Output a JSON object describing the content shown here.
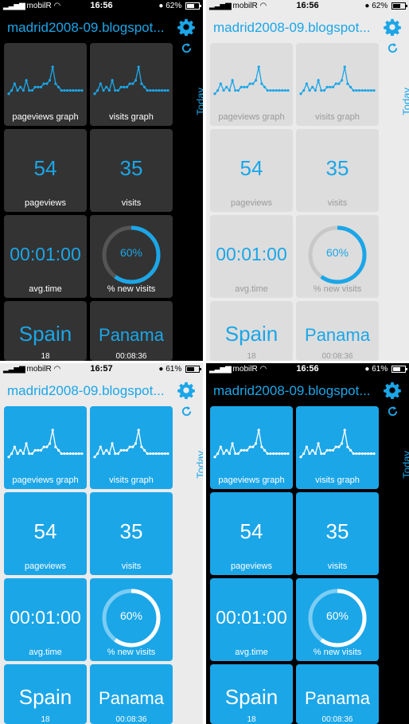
{
  "screens": [
    {
      "carrier": "mobilR",
      "time": "16:56",
      "battery": "62%",
      "battery_level": 0.62
    },
    {
      "carrier": "mobilR",
      "time": "16:56",
      "battery": "62%",
      "battery_level": 0.62
    },
    {
      "carrier": "mobilR",
      "time": "16:57",
      "battery": "61%",
      "battery_level": 0.61
    },
    {
      "carrier": "mobilR",
      "time": "16:56",
      "battery": "61%",
      "battery_level": 0.61
    }
  ],
  "header": {
    "site": "madrid2008-09.blogspot..."
  },
  "sidebar": {
    "period": "Today"
  },
  "tiles": {
    "pageviews_graph": "pageviews graph",
    "visits_graph": "visits graph",
    "pageviews_value": "54",
    "pageviews_label": "pageviews",
    "visits_value": "35",
    "visits_label": "visits",
    "avg_time_value": "00:01:00",
    "avg_time_label": "avg.time",
    "new_visits_pct": "60%",
    "new_visits_fraction": 0.6,
    "new_visits_label": "% new visits",
    "country1": "Spain",
    "country1_sub": "18",
    "country2": "Panama",
    "country2_sub": "00:08:36"
  },
  "sparkline": [
    1,
    2,
    4,
    2,
    3,
    2,
    5,
    2,
    2,
    3,
    3,
    3,
    4,
    4,
    5,
    9,
    4,
    3,
    2,
    2,
    2,
    2,
    2,
    2,
    2,
    2
  ],
  "icons": {
    "settings": "gear-icon",
    "refresh": "refresh-icon",
    "wifi": "wifi-icon",
    "battery": "battery-icon",
    "signal": "signal-icon",
    "rotation_lock": "rotation-lock-icon"
  },
  "themes": [
    {
      "bg": "#000000",
      "tileBg": "#333333",
      "text": "#1ba6e8",
      "label": "#ffffff",
      "spark": "#1ba6e8",
      "ring": "#555555",
      "ringFill": "#1ba6e8",
      "status": "#ffffff"
    },
    {
      "bg": "#ebebeb",
      "tileBg": "#dddddd",
      "text": "#1ba6e8",
      "label": "#9a9a9a",
      "spark": "#1ba6e8",
      "ring": "#c8c8c8",
      "ringFill": "#1ba6e8",
      "status": "#000000"
    },
    {
      "bg": "#ebebeb",
      "tileBg": "#1ba6e8",
      "text": "#ffffff",
      "label": "#ffffff",
      "spark": "#ffffff",
      "ring": "#7ccdf3",
      "ringFill": "#ffffff",
      "status": "#000000"
    },
    {
      "bg": "#000000",
      "tileBg": "#1ba6e8",
      "text": "#ffffff",
      "label": "#ffffff",
      "spark": "#ffffff",
      "ring": "#7ccdf3",
      "ringFill": "#ffffff",
      "status": "#ffffff"
    }
  ]
}
